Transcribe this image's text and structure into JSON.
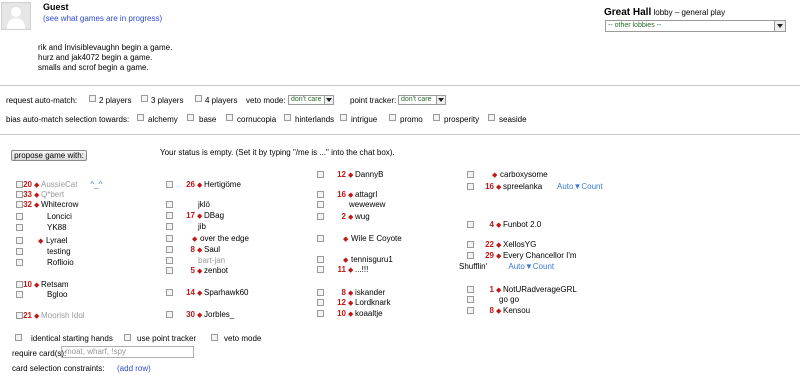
{
  "header": {
    "username": "Guest",
    "games_link": "(see what games are in progress)",
    "events": [
      "rik and Invisiblevaughn begin a game.",
      "hurz and jak4072 begin a game.",
      "smalls and scrof begin a game."
    ],
    "hall_name": "Great Hall",
    "hall_subtitle": "lobby – general play",
    "lobby_select": "-- other lobbies --"
  },
  "automatch": {
    "label": "request auto-match:",
    "players": [
      "2 players",
      "3 players",
      "4 players"
    ],
    "veto_label": "veto mode:",
    "veto_value": "don't care",
    "tracker_label": "point tracker:",
    "tracker_value": "don't care",
    "bias_label": "bias auto-match selection towards:",
    "sets": [
      "alchemy",
      "base",
      "cornucopia",
      "hinterlands",
      "intrigue",
      "promo",
      "prosperity",
      "seaside"
    ]
  },
  "main": {
    "propose_button": "propose game with:",
    "status": "Your status is empty. (Set it by typing \"/me is ...\" into the chat box)."
  },
  "players": {
    "col1": [
      {
        "num": "20",
        "name": "AussieCat",
        "grey": true,
        "extra": "^_^"
      },
      {
        "num": "33",
        "name": "Q*bert",
        "grey": true
      },
      {
        "num": "32",
        "name": "Whitecrow"
      },
      {
        "name": "Loncici"
      },
      {
        "name": "YK88"
      },
      {
        "dia": true,
        "name": "Lyrael"
      },
      {
        "name": "testing"
      },
      {
        "name": "Roflioio"
      },
      {
        "num": "10",
        "name": "Retsam"
      },
      {
        "name": "Bgloo"
      },
      {
        "num": "21",
        "name": "Moorish Idol",
        "grey": true
      }
    ],
    "col2": [
      {
        "num": "26",
        "name": "Hertigöme"
      },
      {
        "name": "jklö"
      },
      {
        "num": "17",
        "name": "DBag"
      },
      {
        "name": "jib"
      },
      {
        "dia": true,
        "name": "over the edge"
      },
      {
        "num": "8",
        "name": "Saul"
      },
      {
        "name": "bart-jan",
        "grey": true
      },
      {
        "num": "5",
        "name": "zenbot"
      },
      {
        "num": "14",
        "name": "Sparhawk60"
      },
      {
        "num": "30",
        "name": "Jorbles_"
      }
    ],
    "col3": [
      {
        "num": "12",
        "name": "DannyB"
      },
      {
        "num": "16",
        "name": "attagrl"
      },
      {
        "name": "wewewew"
      },
      {
        "num": "2",
        "name": "wug"
      },
      {
        "dia": true,
        "name": "Wile E Coyote"
      },
      {
        "dia": true,
        "name": "tennisguru1"
      },
      {
        "num": "11",
        "name": "...!!!"
      },
      {
        "num": "8",
        "name": "iskander"
      },
      {
        "num": "12",
        "name": "Lordknark"
      },
      {
        "num": "10",
        "name": "koaaltje"
      }
    ],
    "col4": [
      {
        "dia": true,
        "name": "carboxysome"
      },
      {
        "num": "16",
        "name": "spreelanka",
        "extra": "Auto▼Count"
      },
      {
        "num": "4",
        "name": "Funbot 2.0"
      },
      {
        "num": "22",
        "name": "XellosYG"
      },
      {
        "num": "29",
        "name": "Every Chancellor I'm"
      },
      {
        "name": "Shufflin'",
        "extra": "Auto▼Count"
      },
      {
        "num": "1",
        "name": "NotURadverageGRL"
      },
      {
        "name": "go go"
      },
      {
        "num": "8",
        "name": "Kensou"
      }
    ]
  },
  "options": {
    "identical": "identical starting hands",
    "point_tracker": "use point tracker",
    "veto": "veto mode",
    "require_label": "require card(s):",
    "require_placeholder": "moat, wharf, !spy",
    "constraints_label": "card selection constraints:",
    "add_row": "(add row)"
  }
}
